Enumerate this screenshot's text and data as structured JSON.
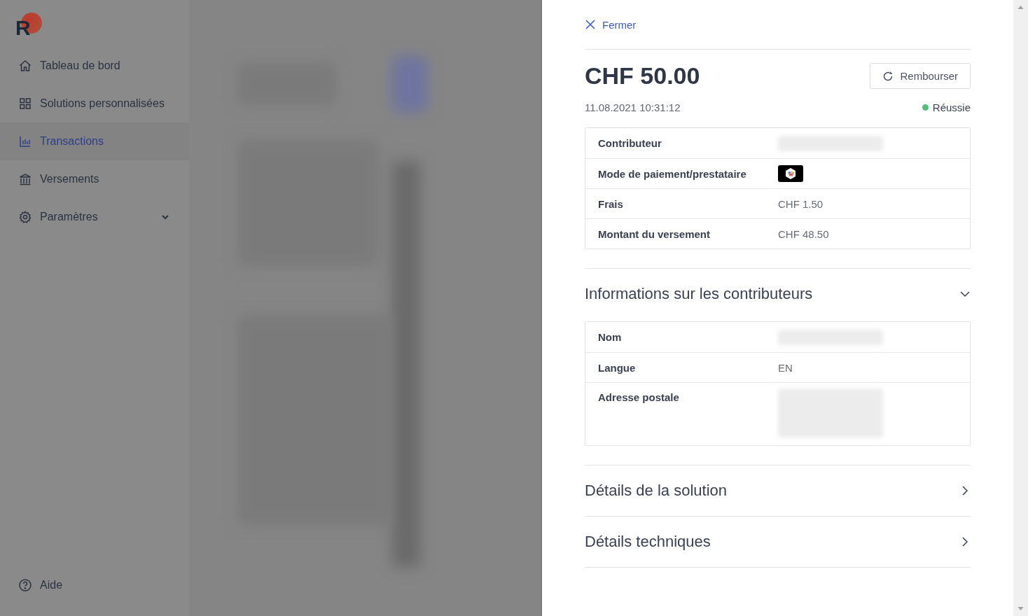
{
  "logo": {
    "text": "R"
  },
  "sidebar": {
    "items": [
      {
        "label": "Tableau de bord",
        "kind": "home",
        "selected": false
      },
      {
        "label": "Solutions personnalisées",
        "kind": "grid",
        "selected": false
      },
      {
        "label": "Transactions",
        "kind": "chart",
        "selected": true
      },
      {
        "label": "Versements",
        "kind": "bank",
        "selected": false
      },
      {
        "label": "Paramètres",
        "kind": "gear",
        "selected": false,
        "expanded": false
      }
    ],
    "help": {
      "label": "Aide"
    }
  },
  "drawer": {
    "close_label": "Fermer",
    "amount": "CHF 50.00",
    "refund_button": "Rembourser",
    "datetime": "11.08.2021 10:31:12",
    "status": {
      "label": "Réussie",
      "color": "#52c07a"
    },
    "details": [
      {
        "label": "Contributeur",
        "kind": "redacted"
      },
      {
        "label": "Mode de paiement/prestataire",
        "kind": "payment_logo"
      },
      {
        "label": "Frais",
        "kind": "text",
        "value": "CHF 1.50"
      },
      {
        "label": "Montant du versement",
        "kind": "text",
        "value": "CHF 48.50"
      }
    ],
    "sections": [
      {
        "title": "Informations sur les contributeurs",
        "expanded": true,
        "rows": [
          {
            "label": "Nom",
            "kind": "redacted"
          },
          {
            "label": "Langue",
            "kind": "text",
            "value": "EN"
          },
          {
            "label": "Adresse postale",
            "kind": "redacted_block"
          }
        ]
      },
      {
        "title": "Détails de la solution",
        "expanded": false
      },
      {
        "title": "Détails techniques",
        "expanded": false
      }
    ]
  }
}
